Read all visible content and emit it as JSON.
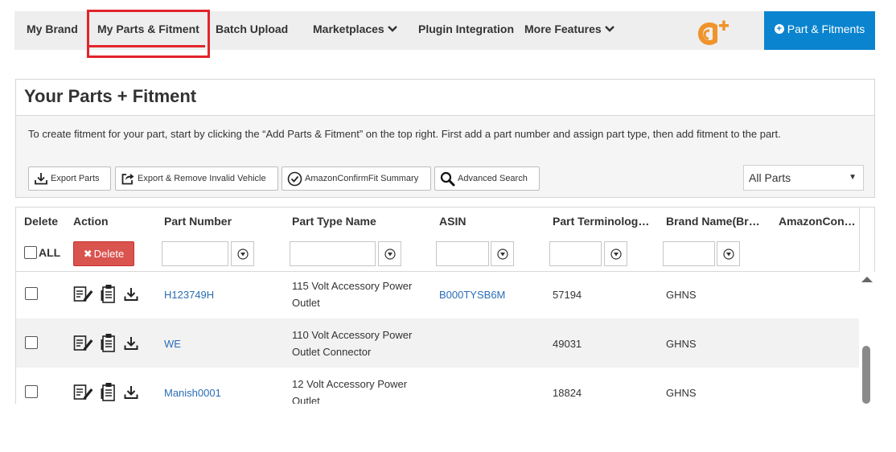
{
  "nav": {
    "items": [
      {
        "label": "My Brand"
      },
      {
        "label": "My Parts & Fitment"
      },
      {
        "label": "Batch Upload"
      },
      {
        "label": "Marketplaces"
      },
      {
        "label": "Plugin Integration"
      },
      {
        "label": "More Features"
      }
    ],
    "add_button_label": "Part & Fitments",
    "accent": "#0a84cf",
    "highlight": "#e2242b",
    "logo_color": "#f0932b"
  },
  "panel": {
    "title": "Your Parts + Fitment",
    "description": "To create fitment for your part, start by clicking the “Add Parts & Fitment” on the top right. First add a part number and assign part type, then add fitment to the part.",
    "buttons": {
      "export": "Export Parts",
      "export_remove": "Export & Remove Invalid Vehicle",
      "amazon_summary": "AmazonConfirmFit Summary",
      "advanced_search": "Advanced Search"
    },
    "filter_select": "All Parts"
  },
  "table": {
    "headers": {
      "delete": "Delete",
      "action": "Action",
      "part_number": "Part Number",
      "part_type": "Part Type Name",
      "asin": "ASIN",
      "terminology": "Part Terminology…",
      "brand": "Brand Name(Bra…",
      "amazon": "AmazonConfir…"
    },
    "all_label": "ALL",
    "delete_button": "Delete",
    "rows": [
      {
        "part_number": "H123749H",
        "type_line1": "115 Volt Accessory Power",
        "type_line2": "Outlet",
        "asin": "B000TYSB6M",
        "terminology": "57194",
        "brand": "GHNS"
      },
      {
        "part_number": "WE",
        "type_line1": "110 Volt Accessory Power",
        "type_line2": "Outlet Connector",
        "asin": "",
        "terminology": "49031",
        "brand": "GHNS"
      },
      {
        "part_number": "Manish0001",
        "type_line1": "12 Volt Accessory Power",
        "type_line2": "Outlet",
        "asin": "",
        "terminology": "18824",
        "brand": "GHNS"
      }
    ]
  }
}
